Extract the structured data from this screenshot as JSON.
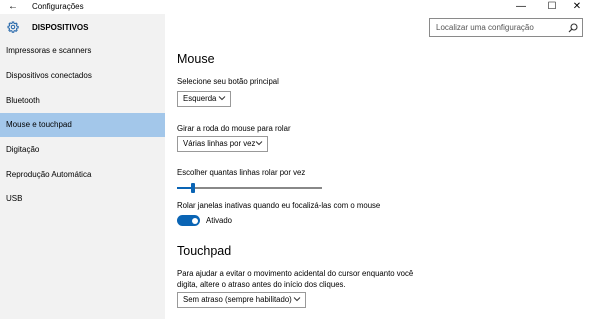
{
  "window": {
    "back_icon": "back-arrow-icon",
    "title": "Configurações",
    "minimize_glyph": "—",
    "maximize_glyph": "☐",
    "close_glyph": "✕"
  },
  "sidebar": {
    "header_icon": "gear-icon",
    "header_label": "DISPOSITIVOS",
    "items": [
      {
        "label": "Impressoras e scanners",
        "active": false
      },
      {
        "label": "Dispositivos conectados",
        "active": false
      },
      {
        "label": "Bluetooth",
        "active": false
      },
      {
        "label": "Mouse e touchpad",
        "active": true
      },
      {
        "label": "Digitação",
        "active": false
      },
      {
        "label": "Reprodução Automática",
        "active": false
      },
      {
        "label": "USB",
        "active": false
      }
    ]
  },
  "search": {
    "placeholder": "Localizar uma configuração",
    "icon": "search-icon"
  },
  "mouse": {
    "heading": "Mouse",
    "primary_button_label": "Selecione seu botão principal",
    "primary_button_value": "Esquerda",
    "wheel_label": "Girar a roda do mouse para rolar",
    "wheel_value": "Várias linhas por vez",
    "lines_label": "Escolher quantas linhas rolar por vez",
    "lines_level_fraction": 0.1,
    "inactive_scroll_label": "Rolar janelas inativas quando eu focalizá-las com o mouse",
    "inactive_scroll_state": "Ativado",
    "inactive_scroll_on": true
  },
  "touchpad": {
    "heading": "Touchpad",
    "description": "Para ajudar a evitar o movimento acidental do cursor enquanto você digita, altere o atraso antes do início dos cliques.",
    "delay_value": "Sem atraso (sempre habilitado)"
  },
  "colors": {
    "accent": "#0a64b4",
    "sidebar_bg": "#f2f2f2",
    "selected_bg": "#a3c7ea"
  }
}
